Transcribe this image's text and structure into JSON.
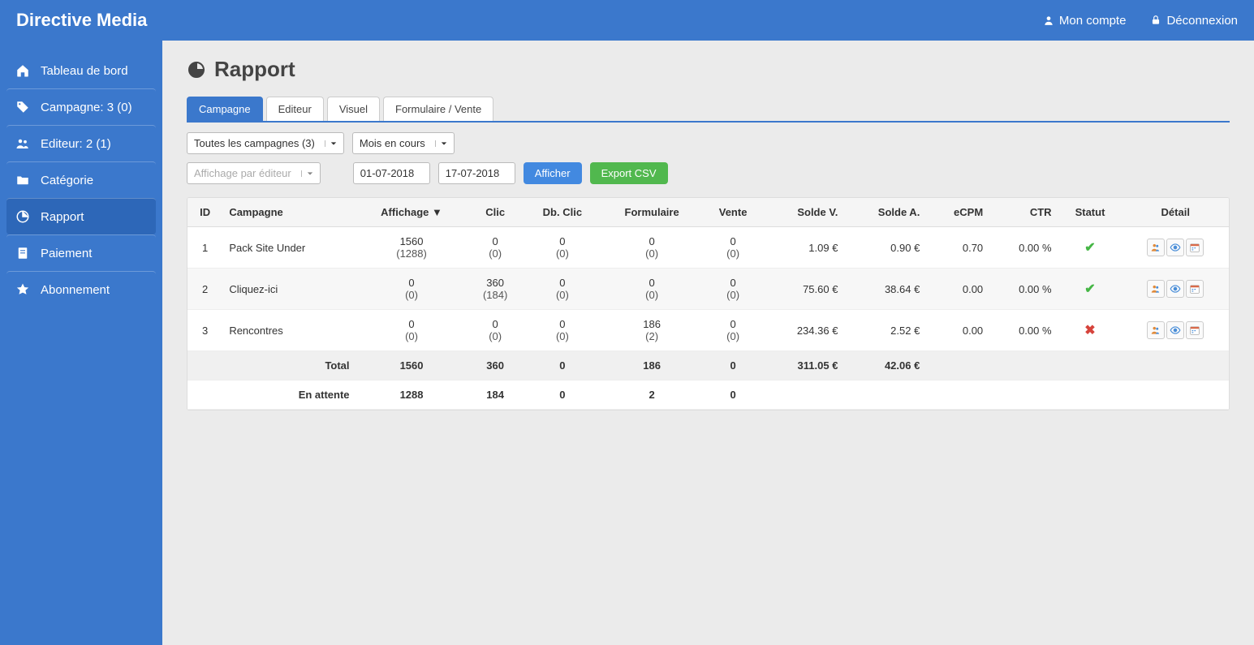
{
  "brand": "Directive Media",
  "top_links": {
    "account": "Mon compte",
    "logout": "Déconnexion"
  },
  "sidebar": {
    "items": [
      {
        "label": "Tableau de bord",
        "active": false
      },
      {
        "label": "Campagne: 3 (0)",
        "active": false
      },
      {
        "label": "Editeur: 2 (1)",
        "active": false
      },
      {
        "label": "Catégorie",
        "active": false
      },
      {
        "label": "Rapport",
        "active": true
      },
      {
        "label": "Paiement",
        "active": false
      },
      {
        "label": "Abonnement",
        "active": false
      }
    ]
  },
  "page": {
    "title": "Rapport"
  },
  "tabs": [
    {
      "label": "Campagne",
      "active": true
    },
    {
      "label": "Editeur",
      "active": false
    },
    {
      "label": "Visuel",
      "active": false
    },
    {
      "label": "Formulaire / Vente",
      "active": false
    }
  ],
  "filters": {
    "campaign_select": "Toutes les campagnes (3)",
    "period_select": "Mois en cours",
    "display_by": "Affichage par éditeur",
    "date_from": "01-07-2018",
    "date_to": "17-07-2018",
    "show_btn": "Afficher",
    "export_btn": "Export CSV"
  },
  "table": {
    "headers": {
      "id": "ID",
      "campagne": "Campagne",
      "affichage": "Affichage ▼",
      "clic": "Clic",
      "dbclic": "Db. Clic",
      "formulaire": "Formulaire",
      "vente": "Vente",
      "soldev": "Solde V.",
      "soldea": "Solde A.",
      "ecpm": "eCPM",
      "ctr": "CTR",
      "statut": "Statut",
      "detail": "Détail"
    },
    "rows": [
      {
        "id": "1",
        "campagne": "Pack Site Under",
        "aff": "1560",
        "aff_sub": "(1288)",
        "clic": "0",
        "clic_sub": "(0)",
        "dbclic": "0",
        "dbclic_sub": "(0)",
        "form": "0",
        "form_sub": "(0)",
        "vente": "0",
        "vente_sub": "(0)",
        "soldev": "1.09 €",
        "soldea": "0.90 €",
        "ecpm": "0.70",
        "ctr": "0.00 %",
        "status": "ok"
      },
      {
        "id": "2",
        "campagne": "Cliquez-ici",
        "aff": "0",
        "aff_sub": "(0)",
        "clic": "360",
        "clic_sub": "(184)",
        "dbclic": "0",
        "dbclic_sub": "(0)",
        "form": "0",
        "form_sub": "(0)",
        "vente": "0",
        "vente_sub": "(0)",
        "soldev": "75.60 €",
        "soldea": "38.64 €",
        "ecpm": "0.00",
        "ctr": "0.00 %",
        "status": "ok"
      },
      {
        "id": "3",
        "campagne": "Rencontres",
        "aff": "0",
        "aff_sub": "(0)",
        "clic": "0",
        "clic_sub": "(0)",
        "dbclic": "0",
        "dbclic_sub": "(0)",
        "form": "186",
        "form_sub": "(2)",
        "vente": "0",
        "vente_sub": "(0)",
        "soldev": "234.36 €",
        "soldea": "2.52 €",
        "ecpm": "0.00",
        "ctr": "0.00 %",
        "status": "bad"
      }
    ],
    "total": {
      "label": "Total",
      "aff": "1560",
      "clic": "360",
      "dbclic": "0",
      "form": "186",
      "vente": "0",
      "soldev": "311.05 €",
      "soldea": "42.06 €"
    },
    "pending": {
      "label": "En attente",
      "aff": "1288",
      "clic": "184",
      "dbclic": "0",
      "form": "2",
      "vente": "0"
    }
  }
}
